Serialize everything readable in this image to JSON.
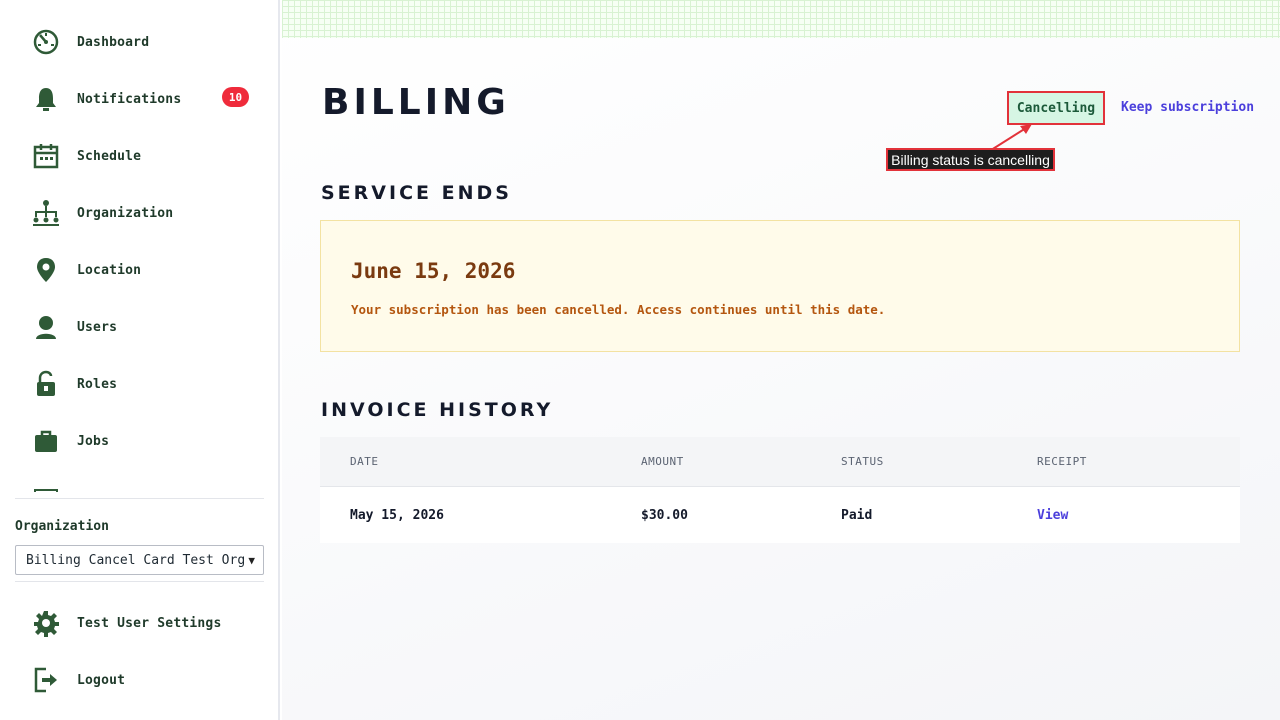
{
  "sidebar": {
    "items": [
      {
        "label": "Dashboard",
        "icon": "dashboard-icon"
      },
      {
        "label": "Notifications",
        "icon": "bell-icon",
        "badge": "10"
      },
      {
        "label": "Schedule",
        "icon": "calendar-icon"
      },
      {
        "label": "Organization",
        "icon": "org-chart-icon"
      },
      {
        "label": "Location",
        "icon": "map-pin-icon"
      },
      {
        "label": "Users",
        "icon": "user-icon"
      },
      {
        "label": "Roles",
        "icon": "lock-icon"
      },
      {
        "label": "Jobs",
        "icon": "briefcase-icon"
      }
    ],
    "org_label": "Organization",
    "org_selected": "Billing Cancel Card Test Org",
    "bottom_items": [
      {
        "label": "Test User Settings",
        "icon": "gear-icon"
      },
      {
        "label": "Logout",
        "icon": "logout-icon"
      }
    ]
  },
  "main": {
    "title": "BILLING",
    "status_label": "Cancelling",
    "keep_link": "Keep subscription",
    "annotation": "Billing status is cancelling",
    "service_section_title": "SERVICE ENDS",
    "service_end_date": "June 15, 2026",
    "service_message": "Your subscription has been cancelled. Access continues until this date.",
    "invoice_section_title": "INVOICE HISTORY",
    "invoice_columns": [
      "DATE",
      "AMOUNT",
      "STATUS",
      "RECEIPT"
    ],
    "invoices": [
      {
        "date": "May 15, 2026",
        "amount": "$30.00",
        "status": "Paid",
        "receipt": "View"
      }
    ]
  },
  "colors": {
    "sidebar_icon": "#2f5a37",
    "badge": "#ef2b3b",
    "link": "#4b3fdc",
    "status_bg": "#d6f6e4",
    "annotation_border": "#e2323a",
    "notice_bg": "#fffbea",
    "notice_date": "#7a3a10",
    "notice_text": "#b4560f"
  }
}
